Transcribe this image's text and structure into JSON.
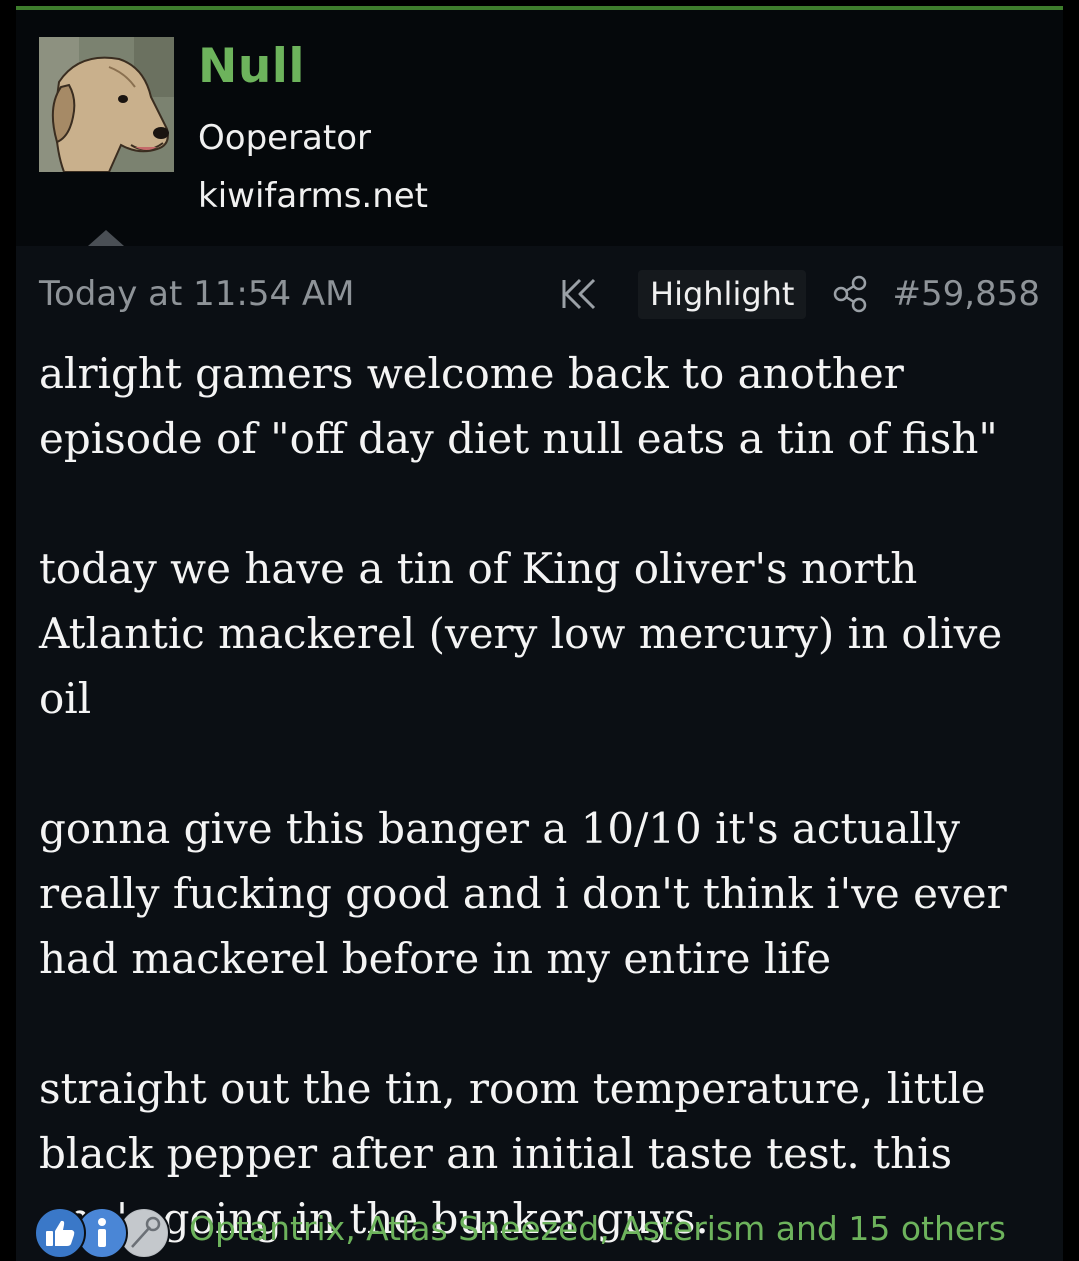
{
  "colors": {
    "accent": "#6db35c",
    "top_border": "#3e7d2c",
    "background": "#0b0f14",
    "muted_text": "#8e9398",
    "body_text": "#f4f4f4"
  },
  "user": {
    "name": "Null",
    "title": "Ooperator",
    "site": "kiwifarms.net",
    "avatar_icon": "dog-avatar"
  },
  "meta": {
    "timestamp": "Today at 11:54 AM",
    "rewind_icon": "rewind-icon",
    "highlight_label": "Highlight",
    "share_icon": "share-icon",
    "post_number": "#59,858"
  },
  "post": {
    "paragraphs": [
      "alright gamers welcome back to another episode of \"off day diet null eats a tin of fish\"",
      "today we have a tin of King oliver's north Atlantic mackerel (very low mercury) in olive oil",
      "gonna give this banger a 10/10 it's actually really fucking good and i don't think i've ever had mackerel before in my entire life",
      "straight out the tin, room temperature, little black pepper after an initial taste test. this one's going in the bunker guys."
    ]
  },
  "reactions": {
    "icons": [
      "thumbs-up-icon",
      "info-icon",
      "pin-icon"
    ],
    "users_text": "Optantrix, Atlas Sneezed, Asterism and 15 others"
  }
}
